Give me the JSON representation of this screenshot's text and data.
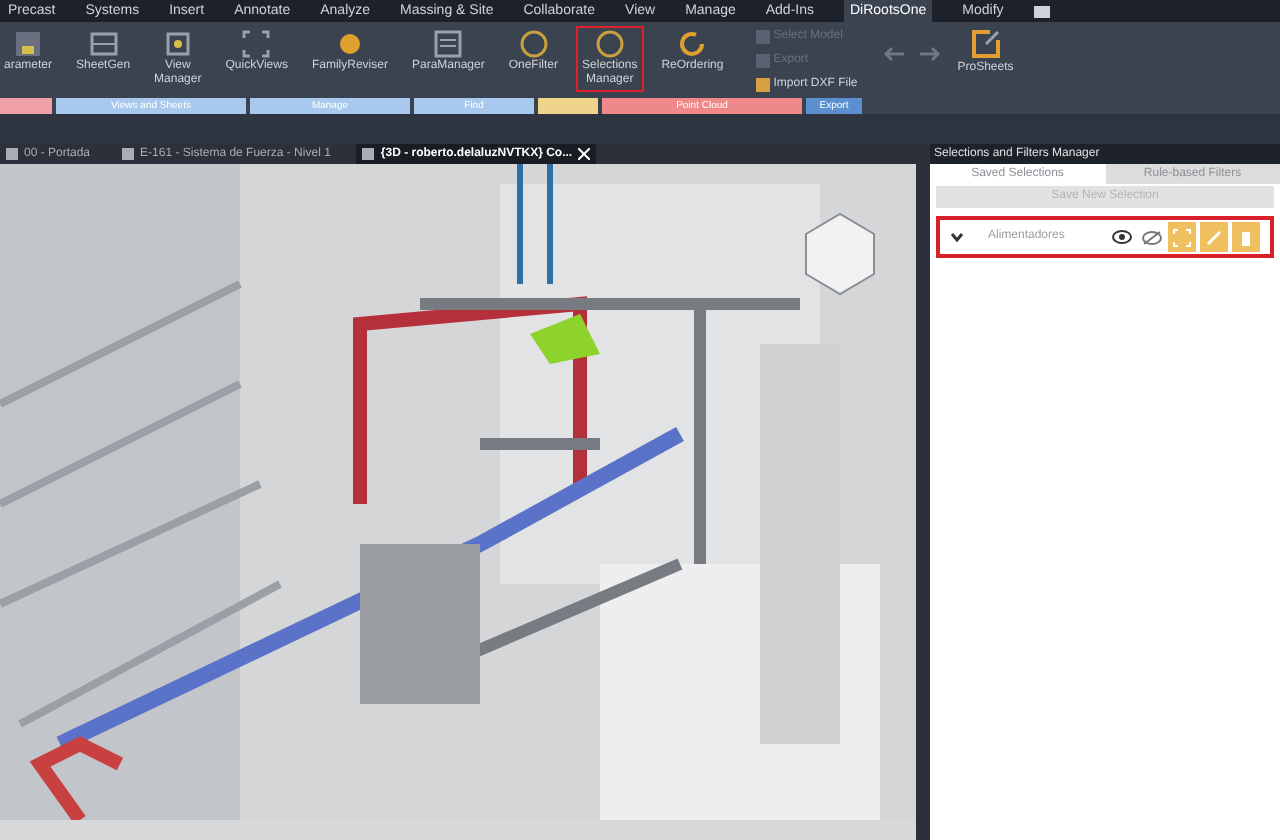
{
  "menu_bar": [
    {
      "label": "Precast",
      "selected": false
    },
    {
      "label": "Systems",
      "selected": false
    },
    {
      "label": "Insert",
      "selected": false
    },
    {
      "label": "Annotate",
      "selected": false
    },
    {
      "label": "Analyze",
      "selected": false
    },
    {
      "label": "Massing & Site",
      "selected": false
    },
    {
      "label": "Collaborate",
      "selected": false
    },
    {
      "label": "View",
      "selected": false
    },
    {
      "label": "Manage",
      "selected": false
    },
    {
      "label": "Add-Ins",
      "selected": false
    },
    {
      "label": "DiRootsOne",
      "selected": true
    },
    {
      "label": "Modify",
      "selected": false
    }
  ],
  "ribbon": {
    "buttons": [
      {
        "label": "arameter",
        "highlighted": false
      },
      {
        "label": "SheetGen",
        "highlighted": false
      },
      {
        "label": "View\nManager",
        "highlighted": false
      },
      {
        "label": "QuickViews",
        "highlighted": false
      },
      {
        "label": "FamilyReviser",
        "highlighted": false
      },
      {
        "label": "ParaManager",
        "highlighted": false
      },
      {
        "label": "OneFilter",
        "highlighted": false
      },
      {
        "label": "Selections\nManager",
        "highlighted": true
      },
      {
        "label": "ReOrdering",
        "highlighted": false
      }
    ],
    "small_buttons": [
      {
        "label": "Select Model",
        "disabled": true
      },
      {
        "label": "Export",
        "disabled": true
      },
      {
        "label": "Import DXF File",
        "disabled": false
      }
    ],
    "large_button": {
      "label": "ProSheets"
    },
    "panels": [
      {
        "color": "#f0a0a8"
      },
      {
        "label": "Views and Sheets",
        "color": "#a9c8ee"
      },
      {
        "label": "Manage",
        "color": "#a9c8ee"
      },
      {
        "label": "Find",
        "color": "#a9c8ee"
      },
      {
        "color": "#efd48c"
      },
      {
        "label": "Point Cloud",
        "color": "#ef8888"
      },
      {
        "label": "Export",
        "color": "#5b8fd0"
      }
    ]
  },
  "view_tabs": [
    {
      "label": "00 - Portada",
      "selected": false
    },
    {
      "label": "E-161 - Sistema de Fuerza - Nivel 1",
      "selected": false
    },
    {
      "label": "{3D - roberto.delaluzNVTKX} Co...",
      "selected": true
    }
  ],
  "panel": {
    "title": "Selections and Filters Manager",
    "tabs": [
      {
        "label": "Saved Selections",
        "selected": true
      },
      {
        "label": "Rule-based Filters",
        "selected": false
      }
    ],
    "save_button": {
      "label": "Save New Selection",
      "disabled": true
    },
    "selections": [
      {
        "name": "Alimentadores",
        "expanded": false,
        "highlighted": true
      }
    ]
  }
}
